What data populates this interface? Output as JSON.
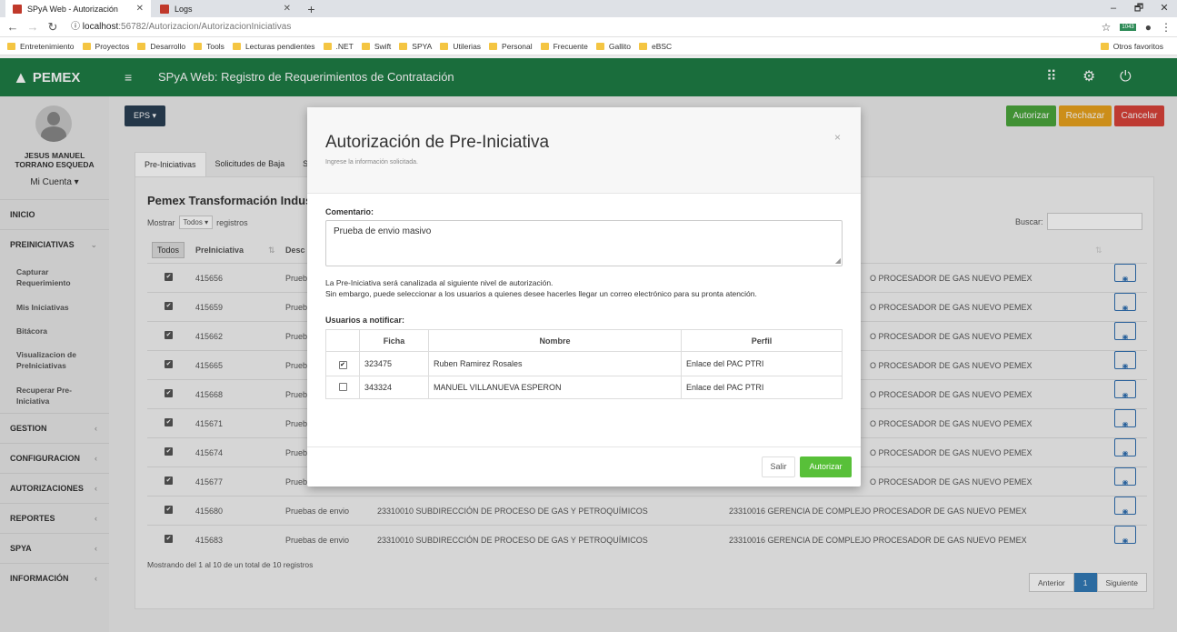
{
  "browser": {
    "tabs": [
      {
        "title": "SPyA Web - Autorización"
      },
      {
        "title": "Logs"
      }
    ],
    "new_tab": "+",
    "window_controls": {
      "minimize": "–",
      "restore": "🗗",
      "close": "✕"
    },
    "url": {
      "host": "localhost",
      "path": ":56782/Autorizacion/AutorizacionIniciativas"
    },
    "badge": "1043",
    "bookmarks": [
      "Entretenimiento",
      "Proyectos",
      "Desarrollo",
      "Tools",
      "Lecturas pendientes",
      ".NET",
      "Swift",
      "SPYA",
      "Utilerias",
      "Personal",
      "Frecuente",
      "Gallito",
      "eBSC"
    ],
    "other_bookmarks": "Otros favoritos"
  },
  "app": {
    "logo": "PEMEX",
    "title": "SPyA Web: Registro de Requerimientos de Contratación",
    "accent": "#1e7d45"
  },
  "sidebar": {
    "user_name_line1": "JESUS MANUEL",
    "user_name_line2": "TORRANO ESQUEDA",
    "account": "Mi Cuenta ▾",
    "sections": {
      "inicio": "INICIO",
      "preiniciativas": "PREINICIATIVAS",
      "gestion": "GESTION",
      "configuracion": "CONFIGURACION",
      "autorizaciones": "AUTORIZACIONES",
      "reportes": "REPORTES",
      "spya": "SPYA",
      "informacion": "INFORMACIÓN"
    },
    "sub_items": {
      "capturar": "Capturar Requerimiento",
      "mis": "Mis Iniciativas",
      "bitacora": "Bitácora",
      "visualizacion": "Visualizacion de PreIniciativas",
      "recuperar": "Recuperar Pre-Iniciativa"
    }
  },
  "main": {
    "eps": "EPS ▾",
    "actions": {
      "autorizar": "Autorizar",
      "rechazar": "Rechazar",
      "cancelar": "Cancelar"
    },
    "tabs": {
      "t1": "Pre-Iniciativas",
      "t2": "Solicitudes de Baja",
      "t3": "S"
    },
    "section_title": "Pemex Transformación Industr",
    "show_label": "Mostrar",
    "show_value": "Todos ▾",
    "records_label": "registros",
    "search_label": "Buscar:",
    "todos_btn": "Todos",
    "col_preiniciativa": "PreIniciativa",
    "col_desc": "Desc",
    "rows": [
      {
        "id": "415656",
        "desc": "Prueb",
        "dept": "",
        "gerencia": "O PROCESADOR DE GAS NUEVO PEMEX"
      },
      {
        "id": "415659",
        "desc": "Prueb",
        "dept": "",
        "gerencia": "O PROCESADOR DE GAS NUEVO PEMEX"
      },
      {
        "id": "415662",
        "desc": "Prueb",
        "dept": "",
        "gerencia": "O PROCESADOR DE GAS NUEVO PEMEX"
      },
      {
        "id": "415665",
        "desc": "Prueb",
        "dept": "",
        "gerencia": "O PROCESADOR DE GAS NUEVO PEMEX"
      },
      {
        "id": "415668",
        "desc": "Prueb",
        "dept": "",
        "gerencia": "O PROCESADOR DE GAS NUEVO PEMEX"
      },
      {
        "id": "415671",
        "desc": "Prueb",
        "dept": "",
        "gerencia": "O PROCESADOR DE GAS NUEVO PEMEX"
      },
      {
        "id": "415674",
        "desc": "Prueb",
        "dept": "",
        "gerencia": "O PROCESADOR DE GAS NUEVO PEMEX"
      },
      {
        "id": "415677",
        "desc": "Prueb",
        "dept": "",
        "gerencia": "O PROCESADOR DE GAS NUEVO PEMEX"
      },
      {
        "id": "415680",
        "desc": "Pruebas de envio",
        "dept": "23310010 SUBDIRECCIÓN DE PROCESO DE GAS Y PETROQUÍMICOS",
        "gerencia": "23310016 GERENCIA DE COMPLEJO PROCESADOR DE GAS NUEVO PEMEX"
      },
      {
        "id": "415683",
        "desc": "Pruebas de envio",
        "dept": "23310010 SUBDIRECCIÓN DE PROCESO DE GAS Y PETROQUÍMICOS",
        "gerencia": "23310016 GERENCIA DE COMPLEJO PROCESADOR DE GAS NUEVO PEMEX"
      }
    ],
    "footer_info": "Mostrando del 1 al 10 de un total de 10 registros",
    "pager": {
      "prev": "Anterior",
      "page": "1",
      "next": "Siguiente"
    }
  },
  "modal": {
    "title": "Autorización de Pre-Iniciativa",
    "subtitle": "Ingrese la información solicitada.",
    "close": "×",
    "comment_label": "Comentario:",
    "comment_value": "Prueba de envio masivo",
    "info_line1": "La Pre-Iniciativa será canalizada al siguiente nivel de autorización.",
    "info_line2": "Sin embargo, puede seleccionar a los usuarios a quienes desee hacerles llegar un correo electrónico para su pronta atención.",
    "users_label": "Usuarios a notificar:",
    "headers": {
      "ficha": "Ficha",
      "nombre": "Nombre",
      "perfil": "Perfil"
    },
    "users": [
      {
        "checked": true,
        "ficha": "323475",
        "nombre": "Ruben Ramirez Rosales",
        "perfil": "Enlace del PAC PTRI"
      },
      {
        "checked": false,
        "ficha": "343324",
        "nombre": "MANUEL VILLANUEVA ESPERON",
        "perfil": "Enlace del PAC PTRI"
      }
    ],
    "salir": "Salir",
    "autorizar": "Autorizar"
  }
}
